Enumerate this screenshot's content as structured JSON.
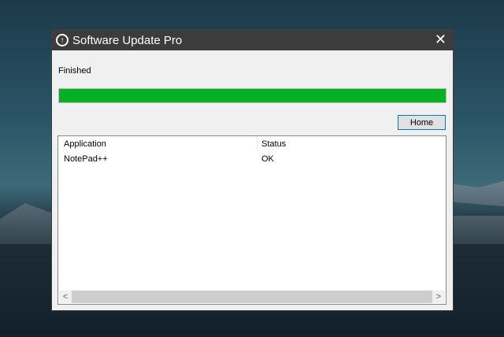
{
  "window": {
    "title": "Software Update Pro",
    "close": "✕"
  },
  "status_text": "Finished",
  "progress_percent": 100,
  "progress_color": "#06b025",
  "home_button": "Home",
  "table": {
    "columns": [
      "Application",
      "Status"
    ],
    "rows": [
      [
        "NotePad++",
        "OK"
      ]
    ]
  },
  "scrollbar": {
    "left": "<",
    "right": ">"
  }
}
